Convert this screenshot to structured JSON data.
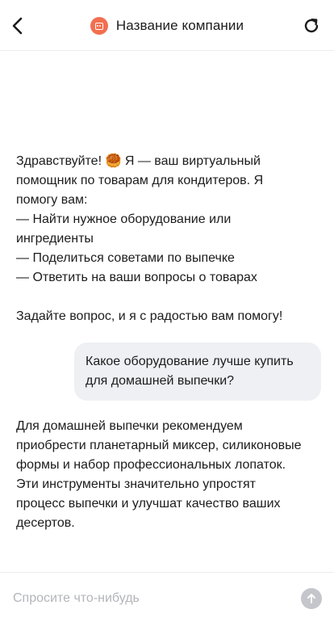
{
  "header": {
    "title": "Название компании",
    "back_icon": "chevron-left-icon",
    "refresh_icon": "refresh-icon",
    "logo_icon": "bot-icon",
    "accent_color": "#f26f4f"
  },
  "messages": {
    "greeting": "Здравствуйте! 🥮 Я — ваш виртуальный\nпомощник по товарам для кондитеров. Я\nпомогу вам:\n— Найти нужное оборудование или\nингредиенты\n— Поделиться советами по выпечке\n— Ответить на ваши вопросы о товарах\n\nЗадайте вопрос, и я с радостью вам помогу!",
    "user_question": "Какое оборудование лучше купить\nдля домашней выпечки?",
    "bot_answer": "Для домашней выпечки рекомендуем\nприобрести планетарный миксер, силиконовые\nформы и набор профессиональных лопаток.\nЭти инструменты значительно упростят\nпроцесс выпечки и улучшат качество ваших\nдесертов."
  },
  "composer": {
    "placeholder": "Спросите что-нибудь",
    "value": "",
    "send_icon": "arrow-up-icon"
  }
}
